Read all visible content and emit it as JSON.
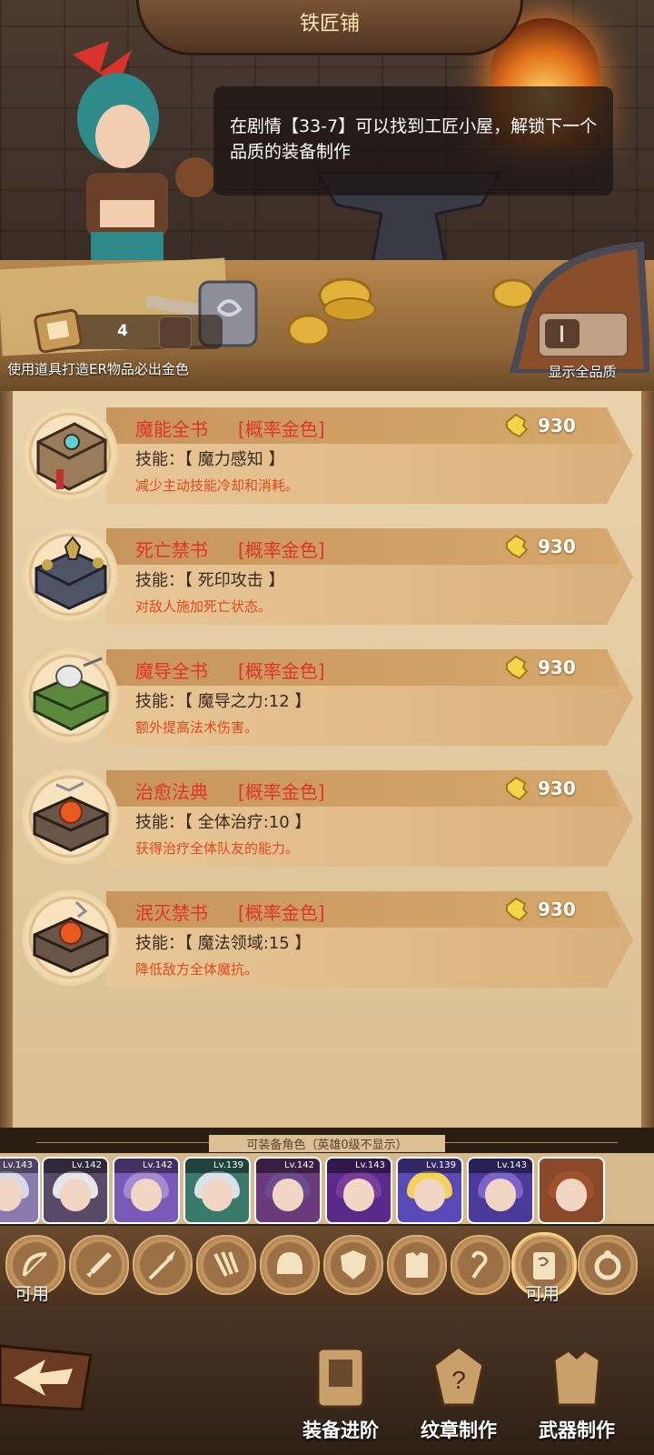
{
  "header": {
    "title": "铁匠铺"
  },
  "npc": {
    "hint": "在剧情【33-7】可以找到工匠小屋，解锁下一个品质的装备制作"
  },
  "scroll": {
    "count": "4",
    "caption": "使用道具打造ER物品必出金色"
  },
  "quality_toggle": {
    "caption": "显示全品质"
  },
  "items": [
    {
      "name": "魔能全书",
      "rate": "[概率金色]",
      "cost": "930",
      "skill": "技能：【 魔力感知 】",
      "desc": "减少主动技能冷却和消耗。",
      "icon": "arcane-tome-icon",
      "cover": "#9a7b5a"
    },
    {
      "name": "死亡禁书",
      "rate": "[概率金色]",
      "cost": "930",
      "skill": "技能：【 死印攻击 】",
      "desc": "对敌人施加死亡状态。",
      "icon": "death-tome-icon",
      "cover": "#4d5566"
    },
    {
      "name": "魔导全书",
      "rate": "[概率金色]",
      "cost": "930",
      "skill": "技能：【 魔导之力:12 】",
      "desc": "额外提高法术伤害。",
      "icon": "magic-guide-tome-icon",
      "cover": "#5c8a3c"
    },
    {
      "name": "治愈法典",
      "rate": "[概率金色]",
      "cost": "930",
      "skill": "技能：【 全体治疗:10 】",
      "desc": "获得治疗全体队友的能力。",
      "icon": "healing-codex-icon",
      "cover": "#6a5648"
    },
    {
      "name": "泯灭禁书",
      "rate": "[概率金色]",
      "cost": "930",
      "skill": "技能：【 魔法领域:15 】",
      "desc": "降低敌方全体魔抗。",
      "icon": "annihilation-tome-icon",
      "cover": "#6a5648"
    }
  ],
  "heroes": {
    "caption": "可装备角色（英雄0级不显示）",
    "list": [
      {
        "level": "Lv.143",
        "hair": "#d9d9e6"
      },
      {
        "level": "Lv.142",
        "hair": "#e6e6ea"
      },
      {
        "level": "Lv.142",
        "hair": "#a58ad2"
      },
      {
        "level": "Lv.139",
        "hair": "#d8e2ea"
      },
      {
        "level": "Lv.142",
        "hair": "#6b4c8f"
      },
      {
        "level": "Lv.143",
        "hair": "#7a3e9a"
      },
      {
        "level": "Lv.139",
        "hair": "#f2d25a"
      },
      {
        "level": "Lv.143",
        "hair": "#7d62c8"
      },
      {
        "level": "",
        "hair": "#a0522d"
      }
    ]
  },
  "categories": {
    "available_label": "可用",
    "list": [
      "bow-icon",
      "sword-icon",
      "spear-icon",
      "claw-icon",
      "helmet-icon",
      "shield-icon",
      "armor-icon",
      "whip-icon",
      "tome-icon",
      "ring-icon"
    ]
  },
  "nav": {
    "upgrade": "装备进阶",
    "emblem": "纹章制作",
    "weapon": "武器制作"
  }
}
